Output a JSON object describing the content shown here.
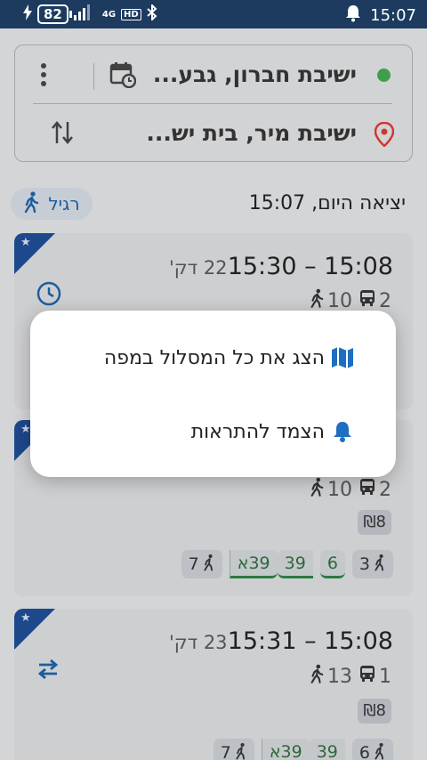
{
  "status_bar": {
    "battery": "82",
    "network": "4G",
    "hd": "HD",
    "time": "15:07"
  },
  "search": {
    "from": "ישיבת חברון, גבע...",
    "to": "ישיבת מיר, בית יש..."
  },
  "departure": {
    "label": "יציאה היום, 15:07",
    "mode": "רגיל"
  },
  "routes": [
    {
      "times": "15:30 – 15:08",
      "duration": "22 דק'",
      "buses": "2",
      "walk": "10"
    },
    {
      "buses": "2",
      "walk": "10",
      "price": "₪8",
      "legs": [
        {
          "type": "walk",
          "value": "3"
        },
        {
          "type": "bus",
          "value": "6"
        },
        {
          "type": "bus",
          "value": "39"
        },
        {
          "type": "bus",
          "value": "39א"
        },
        {
          "type": "walk",
          "value": "7"
        }
      ]
    },
    {
      "times": "15:31 – 15:08",
      "duration": "23 דק'",
      "buses": "1",
      "walk": "13",
      "price": "₪8",
      "legs": [
        {
          "type": "walk",
          "value": "6"
        },
        {
          "type": "bus",
          "value": "39"
        },
        {
          "type": "bus",
          "value": "39א"
        },
        {
          "type": "walk",
          "value": "7"
        }
      ]
    }
  ],
  "menu": {
    "show_map": "הצג את כל המסלול במפה",
    "pin_alerts": "הצמד להתראות"
  },
  "colors": {
    "accent": "#1f5fa0",
    "status_bar": "#1d3a5f",
    "line_green": "#2f7d44",
    "origin_dot": "#3fa34d",
    "destination_pin": "#d23a2e"
  }
}
